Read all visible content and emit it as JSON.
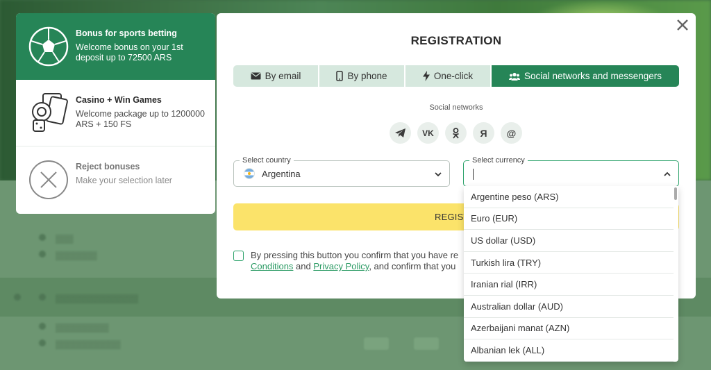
{
  "bonus_panel": {
    "items": [
      {
        "title": "Bonus for sports betting",
        "description": "Welcome bonus on your 1st deposit up to 72500 ARS",
        "icon": "soccer-ball-icon"
      },
      {
        "title": "Casino + Win Games",
        "description": "Welcome package up to 1200000 ARS + 150 FS",
        "icon": "casino-icon"
      },
      {
        "title": "Reject bonuses",
        "description": "Make your selection later",
        "icon": "reject-icon"
      }
    ]
  },
  "modal": {
    "title": "REGISTRATION",
    "tabs": [
      {
        "label": "By email",
        "icon": "envelope-icon"
      },
      {
        "label": "By phone",
        "icon": "phone-icon"
      },
      {
        "label": "One-click",
        "icon": "lightning-icon"
      },
      {
        "label": "Social networks and messengers",
        "icon": "users-icon"
      }
    ],
    "active_tab": "Social networks and messengers",
    "social_networks_label": "Social networks",
    "social": {
      "telegram": "telegram-icon",
      "vk": "VK",
      "ok": "odnoklassniki-icon",
      "yandex": "Я",
      "mail": "@"
    },
    "country": {
      "label": "Select country",
      "value": "Argentina"
    },
    "currency": {
      "label": "Select currency",
      "value": ""
    },
    "register_label": "REGIST",
    "terms": {
      "line1": "By pressing this button you confirm that you have re",
      "link1": "Conditions",
      "and": " and ",
      "link2": "Privacy Policy",
      "line2_rest": ", and confirm that you"
    }
  },
  "currency_options": [
    "Argentine peso (ARS)",
    "Euro (EUR)",
    "US dollar (USD)",
    "Turkish lira (TRY)",
    "Iranian rial (IRR)",
    "Australian dollar (AUD)",
    "Azerbaijani manat (AZN)",
    "Albanian lek (ALL)"
  ],
  "colors": {
    "brand_green": "#268557",
    "tab_bg": "#d6e8de",
    "register_yellow": "#fbe36a",
    "link_green": "#2a9a63"
  }
}
